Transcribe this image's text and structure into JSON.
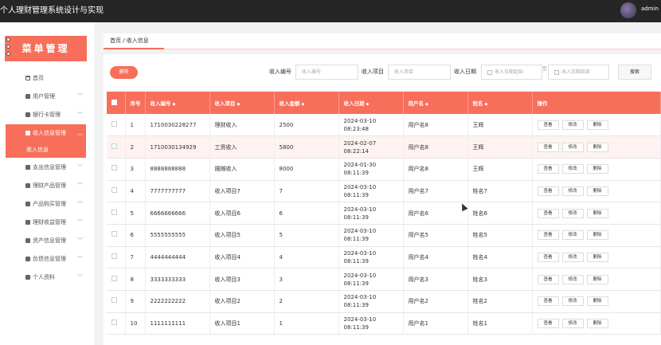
{
  "app": {
    "title": "个人理财管理系统设计与实现",
    "user": "admin"
  },
  "sidebar": {
    "header": "菜单管理",
    "items": [
      {
        "label": "首页",
        "icon": "home-icon"
      },
      {
        "label": "用户管理",
        "icon": "user-icon"
      },
      {
        "label": "银行卡管理",
        "icon": "grid-icon"
      },
      {
        "label": "收入信息管理",
        "icon": "grid-icon"
      },
      {
        "label": "支出信息管理",
        "icon": "grid-icon"
      },
      {
        "label": "理财产品管理",
        "icon": "grid-icon"
      },
      {
        "label": "产品购买管理",
        "icon": "grid-icon"
      },
      {
        "label": "理财收益管理",
        "icon": "grid-icon"
      },
      {
        "label": "资产信息管理",
        "icon": "grid-icon"
      },
      {
        "label": "负债信息管理",
        "icon": "grid-icon"
      },
      {
        "label": "个人资料",
        "icon": "profile-icon"
      }
    ],
    "active_sub": "收入信息"
  },
  "breadcrumb": "首页 / 收入信息",
  "toolbar": {
    "delete_label": "删除",
    "filters": [
      {
        "label": "收入编号",
        "placeholder": "收入编号"
      },
      {
        "label": "收入项目",
        "placeholder": "收入项目"
      },
      {
        "label": "收入日期",
        "placeholder_start": "收入日期起始",
        "placeholder_end": "收入日期结束"
      }
    ],
    "range_sep": "至",
    "search_label": "搜索"
  },
  "table": {
    "columns": [
      "序号",
      "收入编号",
      "收入项目",
      "收入金额",
      "收入日期",
      "用户名",
      "姓名",
      "操作"
    ],
    "actions": [
      "查看",
      "修改",
      "删除"
    ],
    "rows": [
      {
        "no": "1",
        "code": "1710030228277",
        "item": "理财收入",
        "amount": "2500",
        "date": "2024-03-10 08:23:48",
        "username": "用户名8",
        "name": "王辉"
      },
      {
        "no": "2",
        "code": "1710030134929",
        "item": "工资收入",
        "amount": "5800",
        "date": "2024-02-07 08:22:14",
        "username": "用户名8",
        "name": "王辉"
      },
      {
        "no": "3",
        "code": "8888888888",
        "item": "摆摊收入",
        "amount": "8000",
        "date": "2024-01-30 08:11:39",
        "username": "用户名8",
        "name": "王辉"
      },
      {
        "no": "4",
        "code": "7777777777",
        "item": "收入项目7",
        "amount": "7",
        "date": "2024-03-10 08:11:39",
        "username": "用户名7",
        "name": "姓名7"
      },
      {
        "no": "5",
        "code": "6666666666",
        "item": "收入项目6",
        "amount": "6",
        "date": "2024-03-10 08:11:39",
        "username": "用户名6",
        "name": "姓名6"
      },
      {
        "no": "6",
        "code": "5555555555",
        "item": "收入项目5",
        "amount": "5",
        "date": "2024-03-10 08:11:39",
        "username": "用户名5",
        "name": "姓名5"
      },
      {
        "no": "7",
        "code": "4444444444",
        "item": "收入项目4",
        "amount": "4",
        "date": "2024-03-10 08:11:39",
        "username": "用户名4",
        "name": "姓名4"
      },
      {
        "no": "8",
        "code": "3333333333",
        "item": "收入项目3",
        "amount": "3",
        "date": "2024-03-10 08:11:39",
        "username": "用户名3",
        "name": "姓名3"
      },
      {
        "no": "9",
        "code": "2222222222",
        "item": "收入项目2",
        "amount": "2",
        "date": "2024-03-10 08:11:39",
        "username": "用户名2",
        "name": "姓名2"
      },
      {
        "no": "10",
        "code": "1111111111",
        "item": "收入项目1",
        "amount": "1",
        "date": "2024-03-10 08:11:39",
        "username": "用户名1",
        "name": "姓名1"
      }
    ]
  },
  "colors": {
    "accent": "#f76f5a",
    "topbar": "#262626"
  }
}
